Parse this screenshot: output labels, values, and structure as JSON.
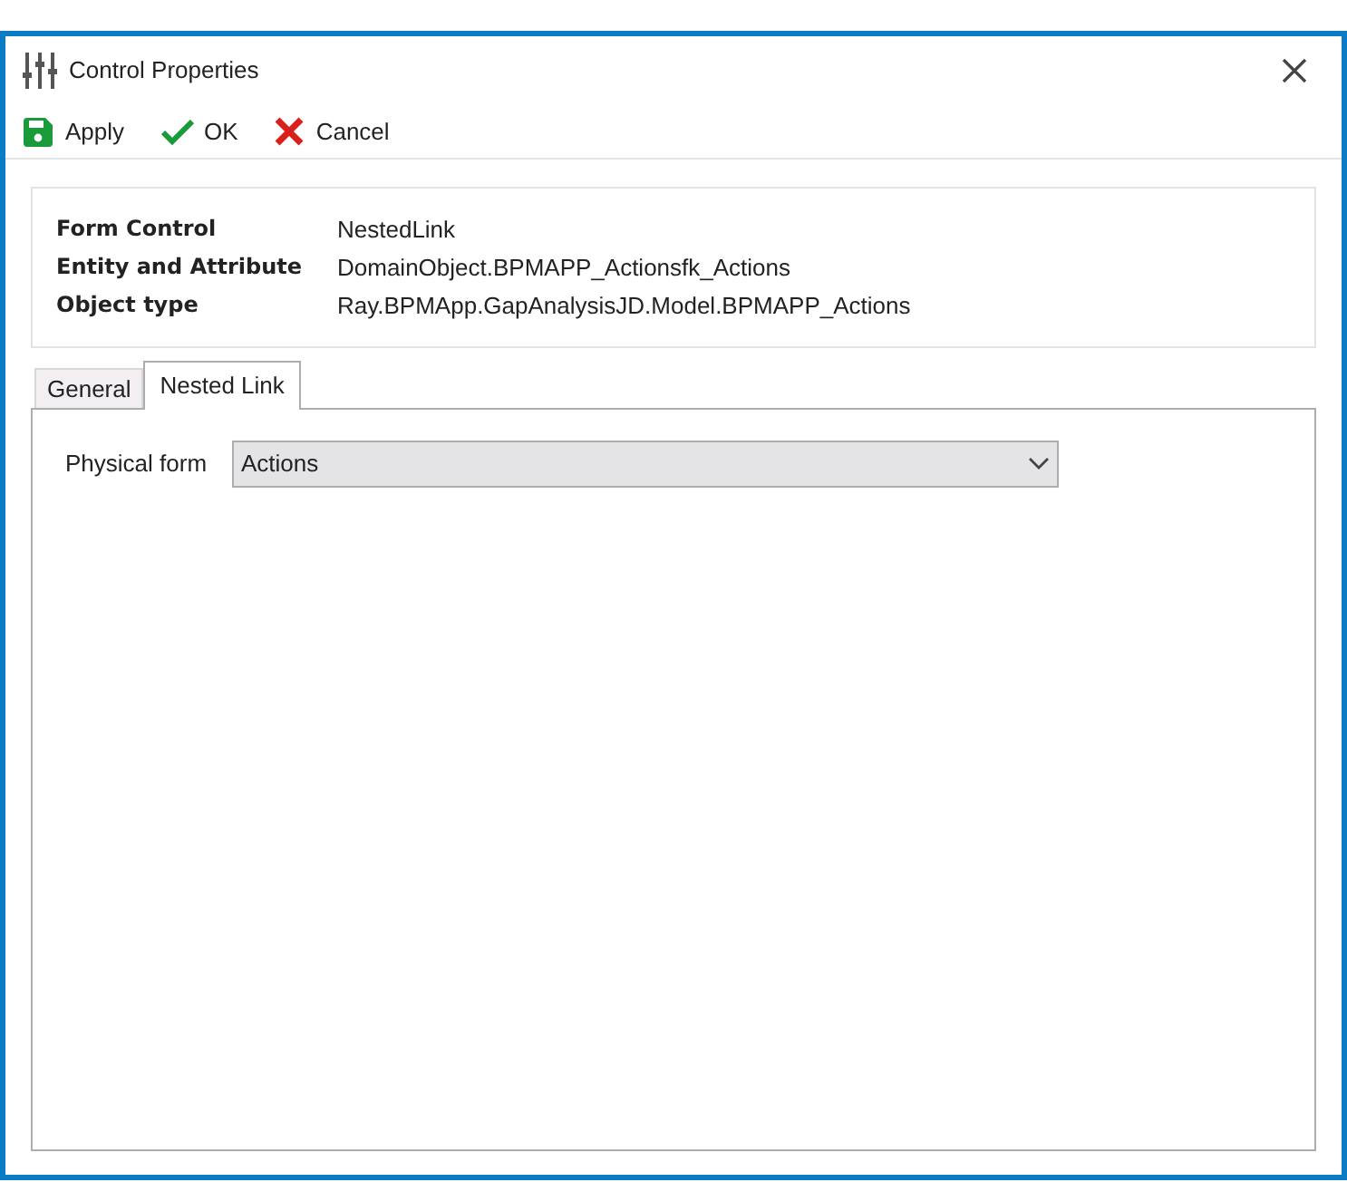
{
  "window": {
    "title": "Control Properties"
  },
  "toolbar": [
    {
      "kind": "apply",
      "label": "Apply"
    },
    {
      "kind": "ok",
      "label": "OK"
    },
    {
      "kind": "cancel",
      "label": "Cancel"
    }
  ],
  "info": [
    {
      "label": "Form Control",
      "value": "NestedLink"
    },
    {
      "label": "Entity and Attribute",
      "value": "DomainObject.BPMAPP_Actionsfk_Actions"
    },
    {
      "label": "Object type",
      "value": "Ray.BPMApp.GapAnalysisJD.Model.BPMAPP_Actions"
    }
  ],
  "tabs": [
    {
      "label": "General",
      "selected": false
    },
    {
      "label": "Nested Link",
      "selected": true
    }
  ],
  "physical_form": {
    "label": "Physical form",
    "value": "Actions"
  }
}
